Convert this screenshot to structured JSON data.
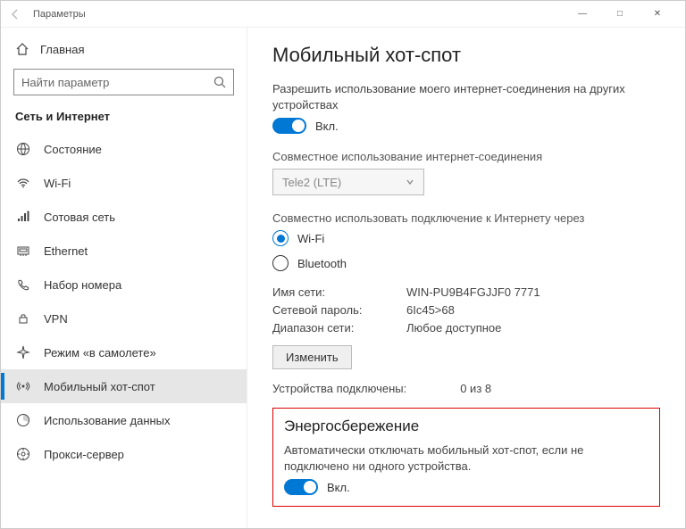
{
  "window": {
    "title": "Параметры",
    "min": "—",
    "max": "□",
    "close": "✕"
  },
  "sidebar": {
    "home": "Главная",
    "search_placeholder": "Найти параметр",
    "section": "Сеть и Интернет",
    "items": [
      {
        "label": "Состояние"
      },
      {
        "label": "Wi-Fi"
      },
      {
        "label": "Сотовая сеть"
      },
      {
        "label": "Ethernet"
      },
      {
        "label": "Набор номера"
      },
      {
        "label": "VPN"
      },
      {
        "label": "Режим «в самолете»"
      },
      {
        "label": "Мобильный хот-спот"
      },
      {
        "label": "Использование данных"
      },
      {
        "label": "Прокси-сервер"
      }
    ]
  },
  "main": {
    "title": "Мобильный хот-спот",
    "share_desc": "Разрешить использование моего интернет-соединения на других устройствах",
    "toggle_on": "Вкл.",
    "share_conn_label": "Совместное использование интернет-соединения",
    "share_conn_value": "Tele2 (LTE)",
    "share_via_label": "Совместно использовать подключение к Интернету через",
    "radio_wifi": "Wi-Fi",
    "radio_bt": "Bluetooth",
    "net_name_label": "Имя сети:",
    "net_name_value": "WIN-PU9B4FGJJF0 7771",
    "net_pass_label": "Сетевой пароль:",
    "net_pass_value": "6Ic45>68",
    "net_band_label": "Диапазон сети:",
    "net_band_value": "Любое доступное",
    "edit_btn": "Изменить",
    "devices_label": "Устройства подключены:",
    "devices_value": "0 из 8",
    "power_title": "Энергосбережение",
    "power_desc": "Автоматически отключать мобильный хот-спот, если не подключено ни одного устройства.",
    "power_toggle": "Вкл."
  }
}
